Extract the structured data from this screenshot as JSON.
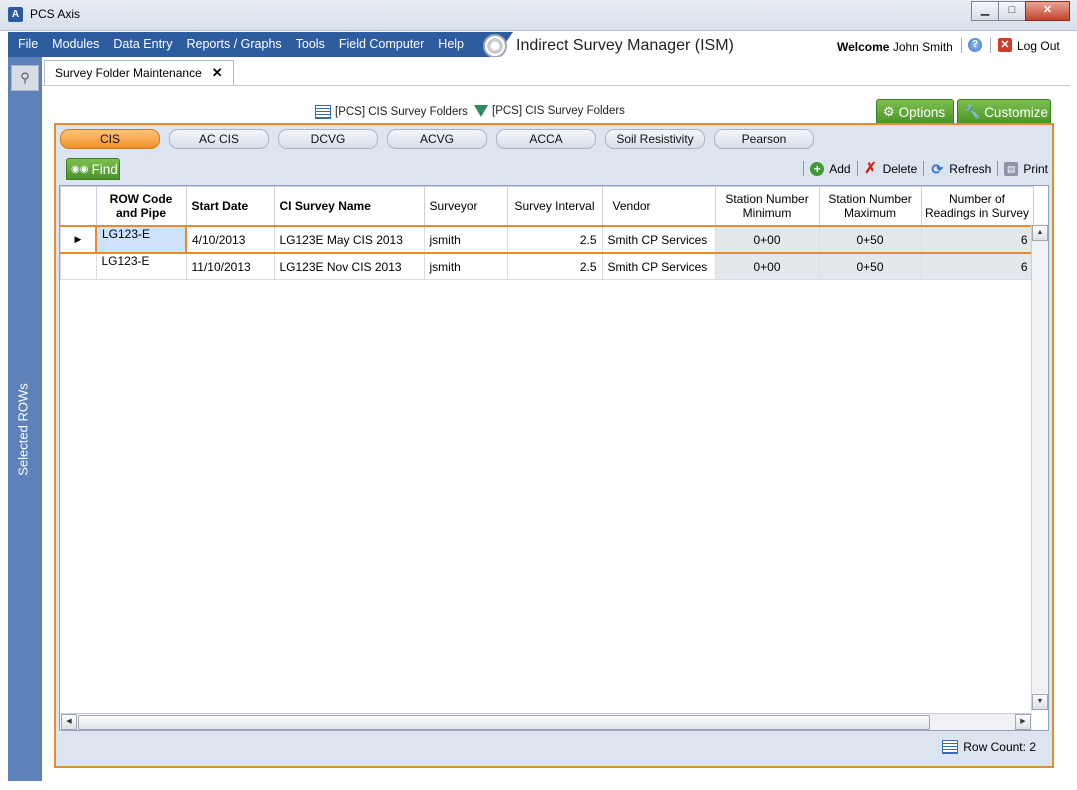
{
  "window": {
    "title": "PCS Axis",
    "app_icon": "pcs-axis-icon",
    "minimize": "▁",
    "maximize": "□",
    "close": "✕"
  },
  "menu": {
    "items": [
      "File",
      "Modules",
      "Data Entry",
      "Reports / Graphs",
      "Tools",
      "Field Computer",
      "Help"
    ],
    "module_title": "Indirect Survey Manager (ISM)",
    "welcome_label": "Welcome",
    "user_name": "John Smith",
    "logout_label": "Log Out"
  },
  "sidebar": {
    "label": "Selected ROWs",
    "search_icon": "search-icon"
  },
  "tab": {
    "label": "Survey Folder Maintenance",
    "close": "✕"
  },
  "sources": [
    {
      "label": "[PCS] CIS Survey Folders",
      "icon": "grid-icon"
    },
    {
      "label": "[PCS] CIS Survey Folders",
      "icon": "triangle-icon"
    }
  ],
  "buttons": {
    "options": "Options",
    "customize": "Customize",
    "find": "Find"
  },
  "survey_tabs": [
    "CIS",
    "AC CIS",
    "DCVG",
    "ACVG",
    "ACCA",
    "Soil Resistivity",
    "Pearson"
  ],
  "active_survey_tab": "CIS",
  "toolbar": {
    "add": "Add",
    "delete": "Delete",
    "refresh": "Refresh",
    "print": "Print"
  },
  "grid": {
    "columns": [
      "ROW Code and Pipe",
      "Start Date",
      "CI Survey Name",
      "Surveyor",
      "Survey Interval",
      "Vendor",
      "Station Number Minimum",
      "Station Number Maximum",
      "Number of Readings in Survey"
    ],
    "rows": [
      [
        "LG123-E",
        "4/10/2013",
        "LG123E May CIS 2013",
        "jsmith",
        "2.5",
        "Smith CP Services",
        "0+00",
        "0+50",
        "6"
      ],
      [
        "LG123-E",
        "11/10/2013",
        "LG123E Nov CIS 2013",
        "jsmith",
        "2.5",
        "Smith CP Services",
        "0+00",
        "0+50",
        "6"
      ]
    ],
    "selected_row": 0,
    "row_count_label": "Row Count:",
    "row_count": "2"
  },
  "colors": {
    "accent": "#e88c2b",
    "menu_blue": "#2d5c9f",
    "green": "#5aa333",
    "panel": "#dce4f0"
  }
}
